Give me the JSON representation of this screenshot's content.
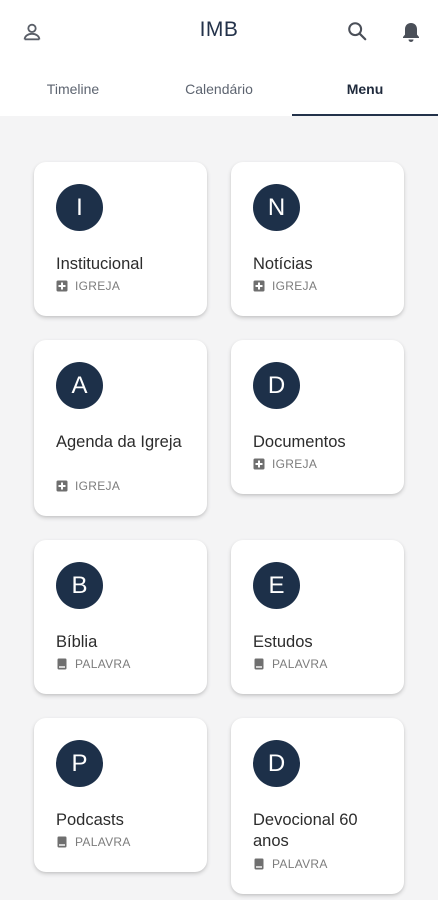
{
  "header": {
    "title": "IMB",
    "profile_icon": "person-outline-icon",
    "search_icon": "search-icon",
    "notifications_icon": "bell-icon"
  },
  "tabs": [
    {
      "label": "Timeline",
      "active": false
    },
    {
      "label": "Calendário",
      "active": false
    },
    {
      "label": "Menu",
      "active": true
    }
  ],
  "menu": {
    "items": [
      {
        "letter": "I",
        "title": "Institucional",
        "category": "IGREJA",
        "category_icon": "church-cross-icon"
      },
      {
        "letter": "N",
        "title": "Notícias",
        "category": "IGREJA",
        "category_icon": "church-cross-icon"
      },
      {
        "letter": "A",
        "title": "Agenda da Igreja",
        "category": "IGREJA",
        "category_icon": "church-cross-icon"
      },
      {
        "letter": "D",
        "title": "Documentos",
        "category": "IGREJA",
        "category_icon": "church-cross-icon"
      },
      {
        "letter": "B",
        "title": "Bíblia",
        "category": "PALAVRA",
        "category_icon": "book-icon"
      },
      {
        "letter": "E",
        "title": "Estudos",
        "category": "PALAVRA",
        "category_icon": "book-icon"
      },
      {
        "letter": "P",
        "title": "Podcasts",
        "category": "PALAVRA",
        "category_icon": "book-icon"
      },
      {
        "letter": "D",
        "title": "Devocional 60 anos",
        "category": "PALAVRA",
        "category_icon": "book-icon"
      }
    ]
  },
  "colors": {
    "primary": "#1d3049",
    "background": "#f4f4f5",
    "card": "#ffffff"
  }
}
